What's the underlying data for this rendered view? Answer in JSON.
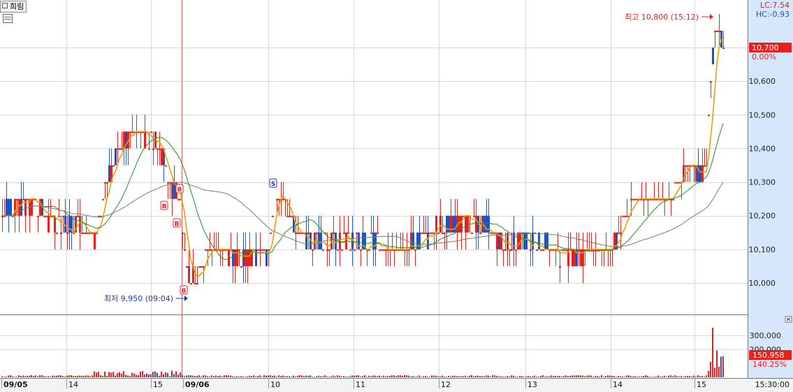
{
  "toolbar": {
    "tab_label": "희림"
  },
  "price_labels": {
    "lc": "LC:7.54",
    "hc": "HC:-0.93",
    "current_price": "10,700",
    "current_change": "0.00%"
  },
  "annotations": {
    "high": "최고 10,800 (15:12)",
    "low": "최저 9,950 (09:04)",
    "signals": [
      "B",
      "B",
      "B",
      "B",
      "S"
    ]
  },
  "volume_labels": {
    "current_volume": "150,958",
    "current_volume_pct": "140.25%"
  },
  "colors": {
    "up": "#e8201c",
    "down": "#1c54c8",
    "ma5": "#e8a000",
    "ma20": "#1f8f1f",
    "ma60": "#7a7a7a",
    "vline": "#e06060"
  },
  "chart_data": [
    {
      "type": "candlestick",
      "title": "",
      "x_ticks": [
        "09/05",
        "14",
        "15",
        "09/06",
        "10",
        "11",
        "12",
        "13",
        "14",
        "15"
      ],
      "x_axis_end_label": "15:30:00",
      "y_ticks": [
        "10,000",
        "10,100",
        "10,200",
        "10,300",
        "10,400",
        "10,500",
        "10,600"
      ],
      "ylim": [
        9950,
        10810
      ],
      "grid": true,
      "high": {
        "value": 10800,
        "time": "15:12"
      },
      "low": {
        "value": 9950,
        "time": "09:04"
      },
      "last_price": 10700,
      "moving_averages": [
        "ma5",
        "ma20",
        "ma60"
      ],
      "segments": [
        {
          "label": "09/05 open",
          "value": 10220
        },
        {
          "label": "09/05 14",
          "value": 10250
        },
        {
          "label": "09/05 14 peak",
          "value": 10450
        },
        {
          "label": "09/05 15",
          "value": 10280
        },
        {
          "label": "09/06 open",
          "value": 10000
        },
        {
          "label": "09/06 10",
          "value": 10270
        },
        {
          "label": "09/06 11",
          "value": 10100
        },
        {
          "label": "09/06 12",
          "value": 10180
        },
        {
          "label": "09/06 13",
          "value": 10080
        },
        {
          "label": "09/06 14",
          "value": 10250
        },
        {
          "label": "09/06 15",
          "value": 10700
        }
      ]
    },
    {
      "type": "bar",
      "title": "",
      "y_ticks": [
        "200,000",
        "300,000"
      ],
      "ylim": [
        0,
        360000
      ],
      "last_volume": 150958,
      "last_volume_pct": 140.25,
      "peak_volume": 355000
    }
  ]
}
